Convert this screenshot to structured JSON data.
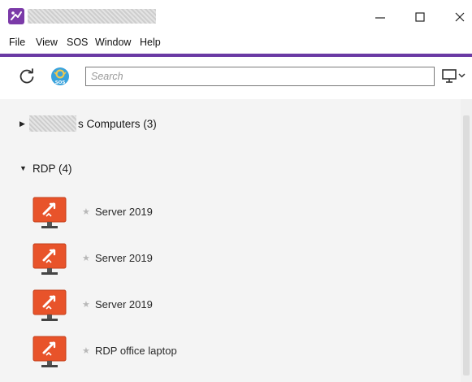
{
  "window": {
    "minimize_symbol": "—",
    "maximize_symbol": "☐",
    "close_symbol": "✕"
  },
  "menu": [
    "File",
    "View",
    "SOS",
    "Window",
    "Help"
  ],
  "toolbar": {
    "refresh_icon": "refresh-icon",
    "sos_icon": "sos-icon",
    "sos_badge": "SOS",
    "search_placeholder": "Search",
    "monitor_icon": "monitor-dropdown-icon"
  },
  "groups": [
    {
      "label": "s Computers (3)",
      "expanded": false,
      "caret": "▶"
    },
    {
      "label": "RDP (4)",
      "expanded": true,
      "caret": "▼"
    }
  ],
  "devices": [
    {
      "name": "Server 2019",
      "star": "★"
    },
    {
      "name": "Server 2019",
      "star": "★"
    },
    {
      "name": "Server 2019",
      "star": "★"
    },
    {
      "name": "RDP office laptop",
      "star": "★"
    }
  ],
  "colors": {
    "accent": "#6a3aa4",
    "rdp_orange": "#e8532a",
    "background": "#f4f4f4"
  }
}
